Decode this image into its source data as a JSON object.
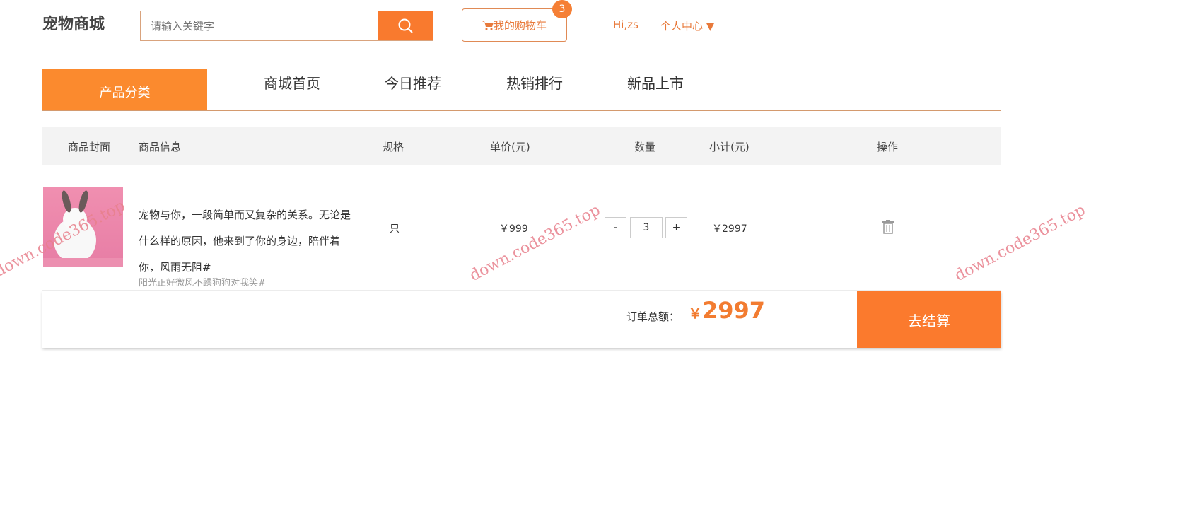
{
  "header": {
    "logo": "宠物商城",
    "search_placeholder": "请输入关键字",
    "cart_label": "我的购物车",
    "cart_count": "3",
    "greeting": "Hi,zs",
    "user_center": "个人中心"
  },
  "nav": {
    "category": "产品分类",
    "items": [
      "商城首页",
      "今日推荐",
      "热销排行",
      "新品上市"
    ]
  },
  "table": {
    "headers": [
      "商品封面",
      "商品信息",
      "规格",
      "单价(元)",
      "数量",
      "小计(元)",
      "操作"
    ],
    "rows": [
      {
        "description": "宠物与你，一段简单而又复杂的关系。无论是什么样的原因，他来到了你的身边，陪伴着你，风雨无阻#",
        "subtitle": "阳光正好微风不躁狗狗对我笑#",
        "spec": "只",
        "price": "￥999",
        "qty": "3",
        "minus": "-",
        "plus": "+",
        "subtotal": "￥2997"
      }
    ]
  },
  "footer": {
    "total_label": "订单总额：",
    "currency": "￥",
    "total": "2997",
    "checkout": "去结算"
  },
  "watermark": "down.code365.top",
  "colors": {
    "accent": "#fb7a2d"
  }
}
